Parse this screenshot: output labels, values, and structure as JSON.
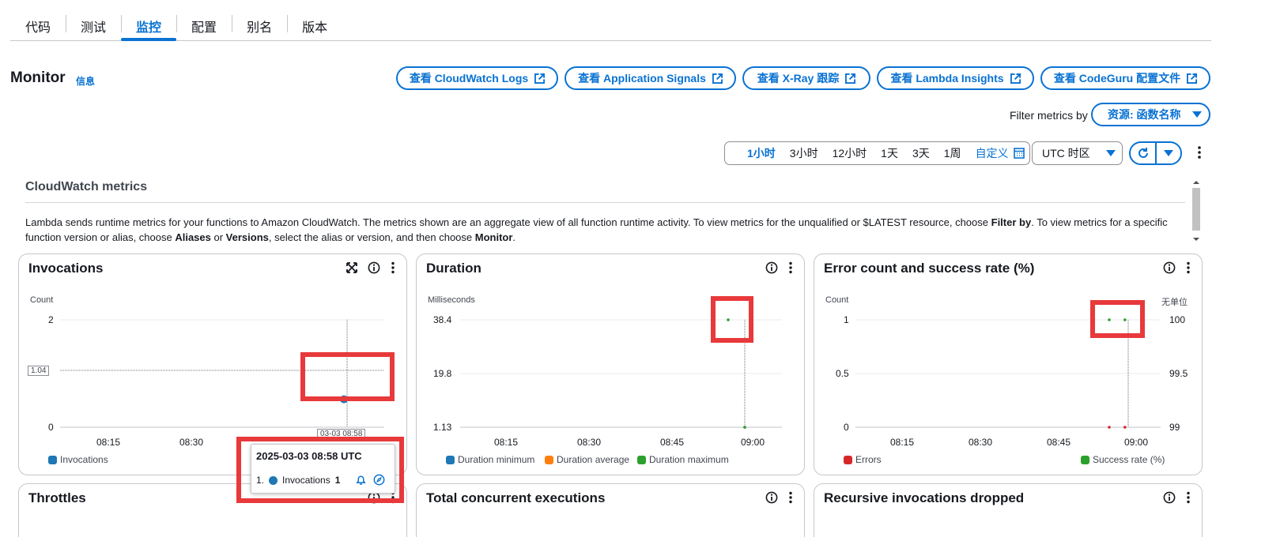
{
  "tabs": [
    {
      "label": "代码",
      "active": false
    },
    {
      "label": "测试",
      "active": false
    },
    {
      "label": "监控",
      "active": true
    },
    {
      "label": "配置",
      "active": false
    },
    {
      "label": "别名",
      "active": false
    },
    {
      "label": "版本",
      "active": false
    }
  ],
  "header": {
    "title": "Monitor",
    "info": "信息"
  },
  "buttons": {
    "cloudwatch_logs": "查看 CloudWatch Logs",
    "app_signals": "查看 Application Signals",
    "xray": "查看 X-Ray 跟踪",
    "lambda_insights": "查看 Lambda Insights",
    "codeguru": "查看 CodeGuru 配置文件"
  },
  "filter": {
    "label": "Filter metrics by",
    "value": "资源: 函数名称"
  },
  "time_range": {
    "options": [
      "1小时",
      "3小时",
      "12小时",
      "1天",
      "3天",
      "1周"
    ],
    "selected": "1小时",
    "custom": "自定义",
    "timezone": "UTC 时区"
  },
  "cloudwatch": {
    "title": "CloudWatch metrics",
    "desc_1": "Lambda sends runtime metrics for your functions to Amazon CloudWatch. The metrics shown are an aggregate view of all function runtime activity. To view metrics for the unqualified or $LATEST resource, choose ",
    "desc_b1": "Filter by",
    "desc_2": ". To view metrics for a specific function version or alias, choose ",
    "desc_b2": "Aliases",
    "desc_3": " or ",
    "desc_b3": "Versions",
    "desc_4": ", select the alias or version, and then choose ",
    "desc_b4": "Monitor",
    "desc_5": "."
  },
  "widgets": {
    "invocations": {
      "title": "Invocations",
      "unit": "Count",
      "legend": "Invocations",
      "y_ticks": [
        "2",
        "0"
      ],
      "ref_value": "1.04",
      "x_cursor_label": "03-03 08:58"
    },
    "duration": {
      "title": "Duration",
      "unit": "Milliseconds",
      "y_ticks": [
        "38.4",
        "19.8",
        "1.13"
      ],
      "legend": [
        "Duration minimum",
        "Duration average",
        "Duration maximum"
      ]
    },
    "errors": {
      "title": "Error count and success rate (%)",
      "unit_left": "Count",
      "unit_right": "无单位",
      "y_left": [
        "1",
        "0.5",
        "0"
      ],
      "y_right": [
        "100",
        "99.5",
        "99"
      ],
      "legend": [
        "Errors",
        "Success rate (%)"
      ]
    },
    "throttles": {
      "title": "Throttles"
    },
    "concurrent": {
      "title": "Total concurrent executions"
    },
    "recursive": {
      "title": "Recursive invocations dropped"
    }
  },
  "x_ticks": [
    "08:15",
    "08:30",
    "08:45",
    "09:00"
  ],
  "tooltip": {
    "title": "2025-03-03 08:58 UTC",
    "index": "1.",
    "series": "Invocations",
    "value": "1"
  },
  "colors": {
    "accent": "#0972d3",
    "invocations": "#1f77b4",
    "duration_min": "#1f77b4",
    "duration_avg": "#ff7f0e",
    "duration_max": "#2ca02c",
    "errors": "#d62728",
    "success": "#2ca02c",
    "highlight": "#e8393b"
  },
  "chart_data": [
    {
      "type": "scatter",
      "title": "Invocations",
      "ylabel": "Count",
      "ylim": [
        0,
        2
      ],
      "x_ticks": [
        "08:15",
        "08:30",
        "08:45",
        "09:00"
      ],
      "series": [
        {
          "name": "Invocations",
          "x": [
            "08:55",
            "08:57",
            "08:58"
          ],
          "values": [
            1,
            1,
            1
          ]
        }
      ]
    },
    {
      "type": "scatter",
      "title": "Duration",
      "ylabel": "Milliseconds",
      "ylim": [
        1.13,
        38.4
      ],
      "x_ticks": [
        "08:15",
        "08:30",
        "08:45",
        "09:00"
      ],
      "series": [
        {
          "name": "Duration minimum",
          "x": [
            "08:58"
          ],
          "values": [
            1.13
          ]
        },
        {
          "name": "Duration average",
          "x": [
            "08:58"
          ],
          "values": [
            1.13
          ]
        },
        {
          "name": "Duration maximum",
          "x": [
            "08:55",
            "08:58"
          ],
          "values": [
            38.4,
            1.13
          ]
        }
      ]
    },
    {
      "type": "scatter",
      "title": "Error count and success rate (%)",
      "ylabel": "Count",
      "ylim": [
        0,
        1
      ],
      "y2label": "无单位",
      "y2lim": [
        99,
        100
      ],
      "x_ticks": [
        "08:15",
        "08:30",
        "08:45",
        "09:00"
      ],
      "series": [
        {
          "name": "Errors",
          "x": [
            "08:55",
            "08:58"
          ],
          "values": [
            0,
            0
          ]
        },
        {
          "name": "Success rate (%)",
          "x": [
            "08:55",
            "08:58"
          ],
          "values": [
            100,
            100
          ],
          "axis": "right"
        }
      ]
    }
  ]
}
